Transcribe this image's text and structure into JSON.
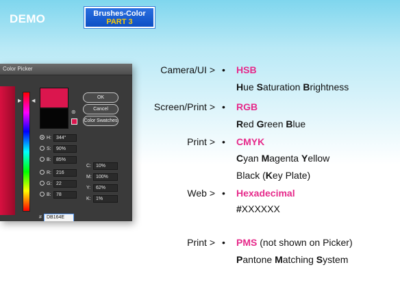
{
  "header": {
    "title": "DEMO",
    "badge_line1": "Brushes-Color",
    "badge_line2": "PART 3"
  },
  "picker": {
    "title": "Color Picker",
    "buttons": {
      "ok": "OK",
      "cancel": "Cancel",
      "swatches": "Color Swatches"
    },
    "fields": {
      "h": {
        "label": "H:",
        "value": "344°"
      },
      "s": {
        "label": "S:",
        "value": "90%"
      },
      "b": {
        "label": "B:",
        "value": "85%"
      },
      "r": {
        "label": "R:",
        "value": "216"
      },
      "g": {
        "label": "G:",
        "value": "22"
      },
      "bl": {
        "label": "B:",
        "value": "78"
      },
      "c": {
        "label": "C:",
        "value": "10%"
      },
      "m": {
        "label": "M:",
        "value": "100%"
      },
      "y": {
        "label": "Y:",
        "value": "62%"
      },
      "k": {
        "label": "K:",
        "value": "1%"
      },
      "hex": {
        "label": "#",
        "value": "DB164E"
      }
    },
    "colors": {
      "new": "#DB164E",
      "old": "#050505"
    }
  },
  "list": {
    "bullet": "•",
    "items": [
      {
        "label": "Camera/UI >",
        "name": "HSB",
        "line1": [
          "H",
          "ue ",
          "S",
          "aturation ",
          "B",
          "rightness"
        ]
      },
      {
        "label": "Screen/Print >",
        "name": "RGB",
        "line1": [
          "R",
          "ed ",
          "G",
          "reen ",
          "B",
          "lue"
        ]
      },
      {
        "label": "Print >",
        "name": "CMYK",
        "line1": [
          "C",
          "yan ",
          "M",
          "agenta ",
          "Y",
          "ellow"
        ],
        "line2": [
          "Black (",
          "K",
          "ey Plate)"
        ]
      },
      {
        "label": "Web >",
        "name": "Hexadecimal",
        "line1": [
          "#",
          "XXXXXX"
        ]
      },
      {
        "label": "Print >",
        "name": "PMS",
        "name_suffix": " (not shown on Picker)",
        "line1": [
          "P",
          "antone ",
          "M",
          "atching ",
          "S",
          "ystem"
        ]
      }
    ]
  },
  "accent_color": "#E6298A"
}
